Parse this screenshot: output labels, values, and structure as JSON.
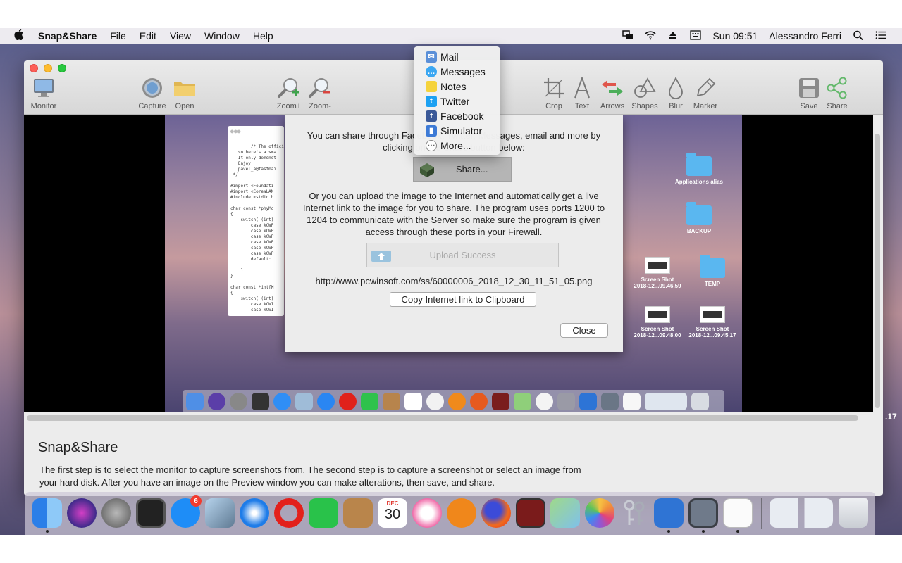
{
  "menubar": {
    "apple": "",
    "app_name": "Snap&Share",
    "menus": [
      "File",
      "Edit",
      "View",
      "Window",
      "Help"
    ],
    "clock": "Sun 09:51",
    "user": "Alessandro Ferri",
    "status_icons": [
      "screen-mirror-icon",
      "wifi-icon",
      "eject-icon",
      "keyboard-input-icon",
      "spotlight-icon",
      "notification-center-icon"
    ]
  },
  "toolbar": {
    "monitor": "Monitor",
    "capture": "Capture",
    "open": "Open",
    "zoom_in": "Zoom+",
    "zoom_out": "Zoom-",
    "crop": "Crop",
    "text": "Text",
    "arrows": "Arrows",
    "shapes": "Shapes",
    "blur": "Blur",
    "marker": "Marker",
    "save": "Save",
    "share": "Share"
  },
  "share_panel": {
    "para1": "You can share through Facebook, Twitter, Messages, email and more by clicking on the Share button below:",
    "share_button": "Share...",
    "para2": "Or you can upload the image to the Internet and automatically get a live Internet link to the image for you to share. The program uses ports 1200 to 1204 to communicate with the Server so make sure the program is given access through these ports in your Firewall.",
    "upload_button": "Upload Success",
    "link": "http://www.pcwinsoft.com/ss/60000006_2018_12_30_11_51_05.png",
    "copy_button": "Copy Internet link to Clipboard",
    "close_button": "Close"
  },
  "share_menu": {
    "items": [
      {
        "label": "Mail",
        "icon": "mail-icon",
        "color": "#5a8fd8"
      },
      {
        "label": "Messages",
        "icon": "messages-icon",
        "color": "#3ba7f2"
      },
      {
        "label": "Notes",
        "icon": "notes-icon",
        "color": "#f5d33c"
      },
      {
        "label": "Twitter",
        "icon": "twitter-icon",
        "color": "#1da1f2"
      },
      {
        "label": "Facebook",
        "icon": "facebook-icon",
        "color": "#3b5998"
      },
      {
        "label": "Simulator",
        "icon": "simulator-icon",
        "color": "#3d7ad6"
      },
      {
        "label": "More...",
        "icon": "more-icon",
        "color": "#888888"
      }
    ]
  },
  "code_window": {
    "text": "/* The official e\n   so here's a sma\n   It only demonst\n   Enjoy!\n   pavel_a@fastmai\n */\n\n#import <Foundati\n#import <CoreWLAN\n#include <stdio.h\n\nchar const *phyMo\n{\n    switch( (int)\n        case kCWP\n        case kCWP\n        case kCWP\n        case kCWP\n        case kCWP\n        case kCWP\n        default:\n\n    }\n}\n\nchar const *intfM\n{\n    switch( (int)\n        case kCWI\n        case kCWI"
  },
  "desktop_icons": {
    "applications_alias": "Applications alias",
    "backup": "BACKUP",
    "screenshot1_name": "Screen Shot",
    "screenshot1_date": "2018-12...09.46.59",
    "temp": "TEMP",
    "screenshot2_name": "Screen Shot",
    "screenshot2_date": "2018-12...09.48.00",
    "screenshot3_name": "Screen Shot",
    "screenshot3_date": "2018-12...09.45.17"
  },
  "info": {
    "title": "Snap&Share",
    "body": "The first step is to select the monitor to capture screenshots from. The second step is to capture a screenshot or select an image from your hard disk. After you have an image on the Preview window you can make alterations, then save, and share."
  },
  "stray_text": ".17",
  "dock": {
    "app_store_badge": "6",
    "calendar_month": "DEC",
    "calendar_day": "30",
    "apps": [
      "Finder",
      "Siri",
      "Launchpad",
      "Activity Monitor",
      "App Store",
      "Mail Preview",
      "Safari",
      "Opera",
      "FaceTime",
      "Contacts",
      "Calendar",
      "iTunes",
      "iBooks",
      "Firefox",
      "Photo Booth",
      "Maps",
      "Photos",
      "Keychain Access",
      "Xcode",
      "Snap&Share",
      "TextEdit",
      "Screenshots",
      "Trash"
    ]
  }
}
